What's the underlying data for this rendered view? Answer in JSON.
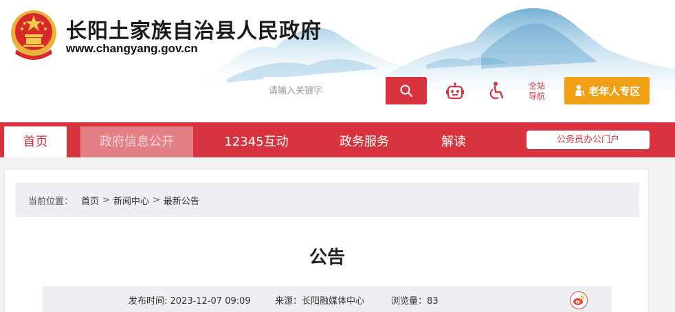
{
  "header": {
    "site_title": "长阳土家族自治县人民政府",
    "site_url": "www.changyang.gov.cn",
    "search_placeholder": "请输入关键字",
    "sitemap_line1": "全站",
    "sitemap_line2": "导航",
    "elder_label": "老年人专区"
  },
  "nav": {
    "items": [
      {
        "label": "首页"
      },
      {
        "label": "政府信息公开"
      },
      {
        "label": "12345互动"
      },
      {
        "label": "政务服务"
      },
      {
        "label": "解读"
      }
    ],
    "portal_label": "公务员办公门户"
  },
  "breadcrumb": {
    "prefix": "当前位置：",
    "items": [
      "首页",
      "新闻中心",
      "最新公告"
    ],
    "separator": ">"
  },
  "article": {
    "title": "公告",
    "publish_time": "发布时间: 2023-12-07 09:09",
    "source": "来源：长阳融媒体中心",
    "views": "浏览量：83"
  },
  "colors": {
    "brand_red": "#d8343f",
    "elder_orange": "#f0a016",
    "meta_bg": "#edeff2"
  },
  "icons": [
    "national-emblem-icon",
    "search-icon",
    "robot-icon",
    "accessibility-icon",
    "elder-person-icon",
    "weibo-icon"
  ]
}
